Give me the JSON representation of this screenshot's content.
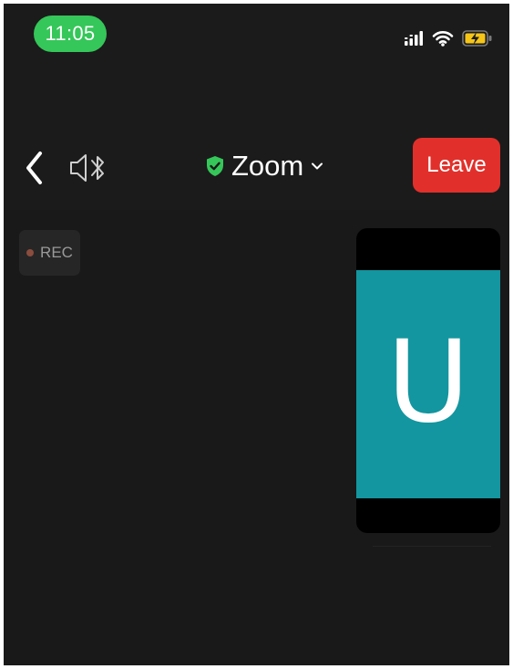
{
  "status_bar": {
    "time": "11:05",
    "icons": [
      "cellular-signal-icon",
      "wifi-icon",
      "battery-charging-icon"
    ]
  },
  "nav_bar": {
    "back_icon": "chevron-left-icon",
    "audio_icon": "speaker-bluetooth-icon",
    "secure_icon": "shield-check-icon",
    "title": "Zoom",
    "dropdown_icon": "chevron-down-icon",
    "leave_label": "Leave"
  },
  "meeting": {
    "recording_label": "REC",
    "participant_initial": "U"
  },
  "colors": {
    "time_pill": "#35c759",
    "leave_button": "#e1302b",
    "avatar_background": "#13969f",
    "shield": "#35c759",
    "battery": "#f5c518",
    "background": "#1b1b1b"
  }
}
